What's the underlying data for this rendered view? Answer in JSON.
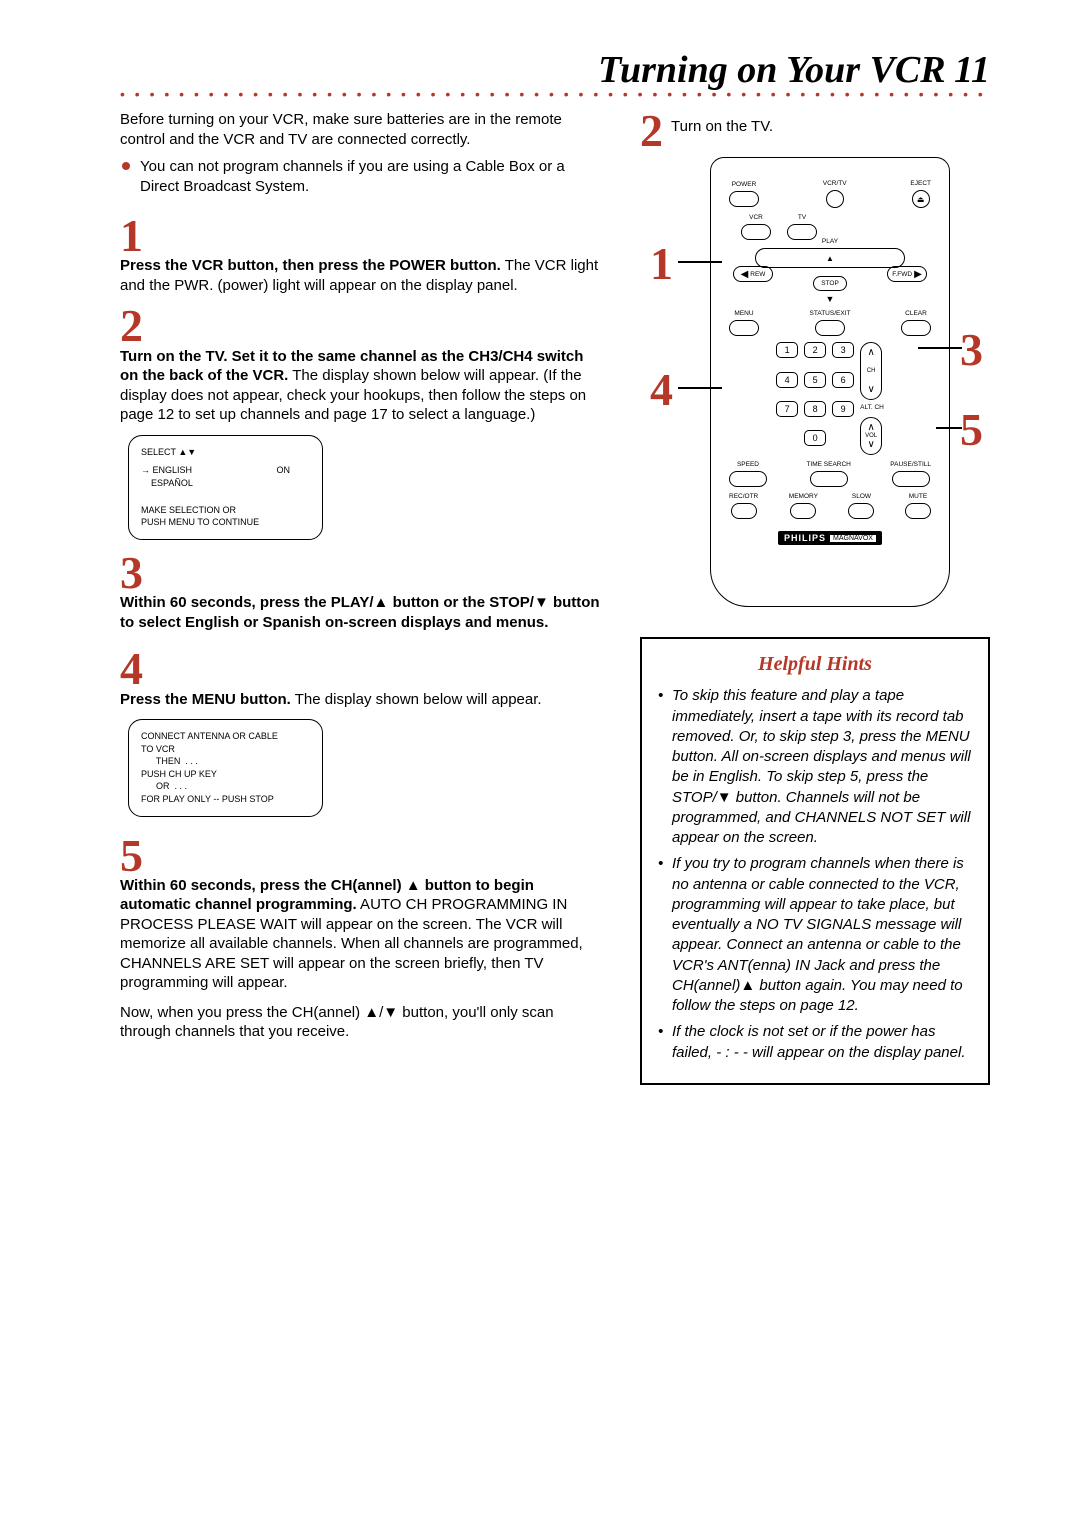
{
  "header": {
    "title": "Turning on Your VCR",
    "page_num": "11"
  },
  "intro": {
    "text": "Before turning on your VCR, make sure batteries are in the remote control and the VCR and TV are connected correctly.",
    "bullet": "You can not program channels if you are using a Cable Box or a Direct Broadcast System."
  },
  "steps": {
    "s1": {
      "num": "1",
      "bold": "Press the VCR button, then press the POWER button.",
      "rest": " The VCR light and the PWR. (power) light will appear on the display panel."
    },
    "s2": {
      "num": "2",
      "bold": "Turn on the TV. Set it to the same channel as the CH3/CH4 switch on the back of the VCR.",
      "rest": " The display shown below will appear. (If the display does not appear, check your hookups, then follow the steps on page 12 to set up channels and page 17 to select a language.)"
    },
    "s3": {
      "num": "3",
      "bold": "Within 60 seconds, press the PLAY/▲ button or the STOP/▼ button to select English or Spanish on-screen displays and menus."
    },
    "s4": {
      "num": "4",
      "bold": "Press the MENU button.",
      "rest": " The display shown below will appear."
    },
    "s5": {
      "num": "5",
      "bold": "Within 60 seconds, press the CH(annel) ▲ button to begin automatic channel programming.",
      "rest": " AUTO CH PROGRAMMING IN PROCESS PLEASE WAIT will appear on the screen. The VCR will memorize all available channels. When all channels are programmed, CHANNELS ARE SET will appear on the screen briefly, then TV programming will appear.",
      "tail": "Now, when you press the CH(annel) ▲/▼ button, you'll only scan through channels that you receive."
    }
  },
  "right_step2": {
    "num": "2",
    "text": "Turn on the TV."
  },
  "osd1": {
    "line1": "SELECT ▲▼",
    "eng": "→ ENGLISH",
    "esp": "    ESPAÑOL",
    "on": "ON",
    "foot1": "MAKE SELECTION OR",
    "foot2": "PUSH MENU TO CONTINUE"
  },
  "osd2": {
    "l1": "CONNECT ANTENNA OR CABLE",
    "l2": "TO VCR",
    "l3": "      THEN  . . .",
    "l4": "PUSH CH UP KEY",
    "l5": "      OR  . . .",
    "l6": "FOR PLAY ONLY -- PUSH STOP"
  },
  "remote": {
    "power": "POWER",
    "vcrtv": "VCR/TV",
    "eject": "EJECT",
    "vcr": "VCR",
    "tv": "TV",
    "play": "PLAY",
    "rew": "REW",
    "ffwd": "F.FWD",
    "stop": "STOP",
    "menu": "MENU",
    "status": "STATUS/EXIT",
    "clear": "CLEAR",
    "ch": "CH",
    "vol": "VOL",
    "altch": "ALT. CH",
    "speed": "SPEED",
    "timesearch": "TIME SEARCH",
    "pause": "PAUSE/STILL",
    "recotr": "REC/OTR",
    "memory": "MEMORY",
    "slow": "SLOW",
    "mute": "MUTE",
    "brand": "PHILIPS",
    "sub": "MAGNAVOX",
    "n0": "0",
    "n1": "1",
    "n2": "2",
    "n3": "3",
    "n4": "4",
    "n5": "5",
    "n6": "6",
    "n7": "7",
    "n8": "8",
    "n9": "9"
  },
  "callouts": {
    "c1": "1",
    "c2": "2",
    "c3": "3",
    "c4": "4",
    "c5": "5"
  },
  "hints": {
    "title": "Helpful Hints",
    "h1": "To skip this feature and play a tape immediately, insert a tape with its record tab removed. Or, to skip step 3, press the MENU button. All on-screen displays and menus will be in English. To skip step 5, press the STOP/▼ button.  Channels will not be programmed, and CHANNELS NOT SET will appear on the screen.",
    "h2": "If you try to program channels when there is no antenna or cable connected to the VCR, programming will appear to take place, but eventually a NO TV SIGNALS message will appear. Connect an antenna or cable to the VCR's ANT(enna) IN Jack and press the CH(annel)▲ button again. You may need to follow the steps on page 12.",
    "h3": "If the clock is not set or if the power has failed, - : - - will appear on the display panel."
  }
}
